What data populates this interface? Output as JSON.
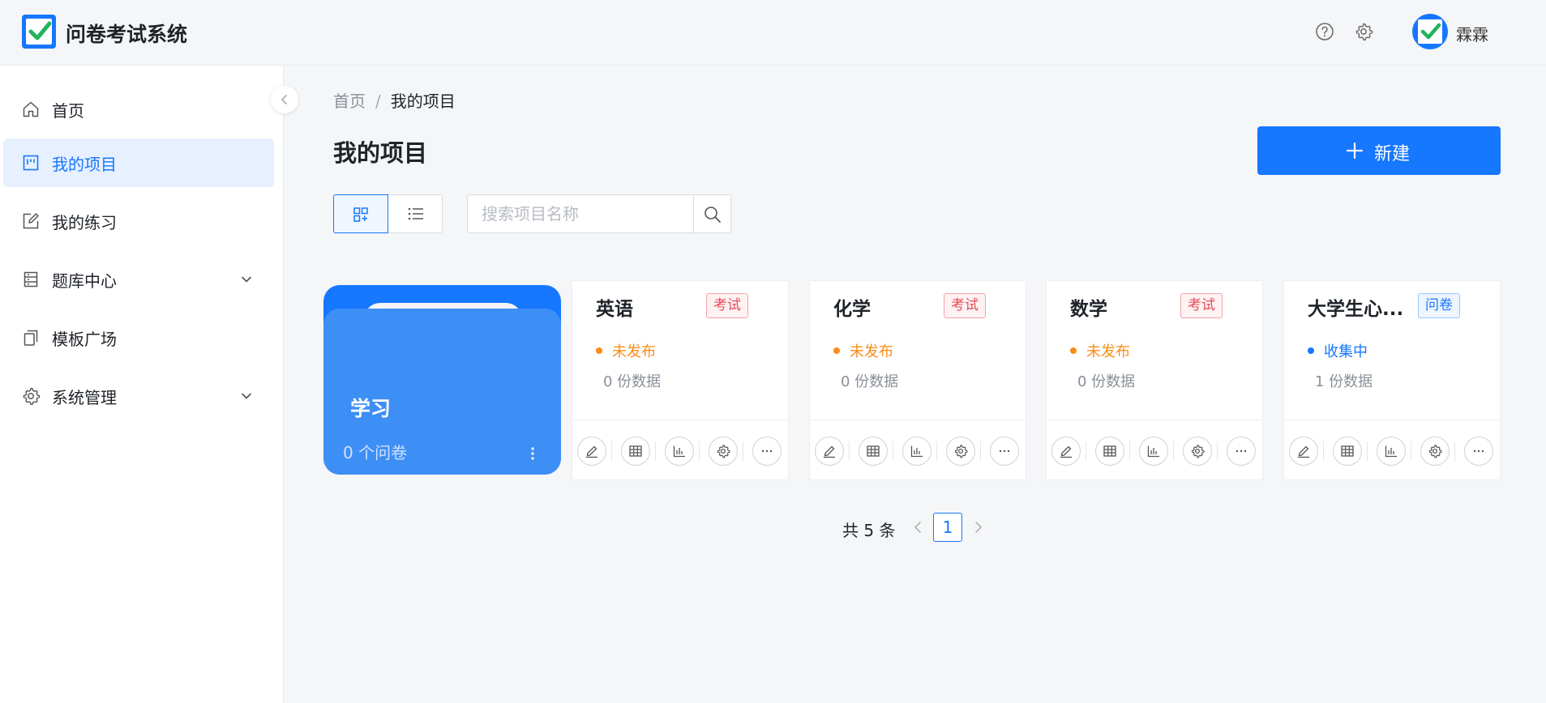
{
  "app": {
    "title": "问卷考试系统",
    "user_name": "霖霖"
  },
  "sidebar": {
    "items": [
      {
        "label": "首页",
        "icon": "home-icon"
      },
      {
        "label": "我的项目",
        "icon": "project-board-icon",
        "active": true
      },
      {
        "label": "我的练习",
        "icon": "edit-square-icon"
      },
      {
        "label": "题库中心",
        "icon": "question-bank-icon",
        "expandable": true
      },
      {
        "label": "模板广场",
        "icon": "template-copy-icon"
      },
      {
        "label": "系统管理",
        "icon": "gear-icon",
        "expandable": true
      }
    ]
  },
  "breadcrumb": {
    "home": "首页",
    "separator": "/",
    "current": "我的项目"
  },
  "main": {
    "title": "我的项目",
    "new_button": "新建",
    "search_placeholder": "搜索项目名称"
  },
  "folder": {
    "name": "学习",
    "count_text": "0 个问卷"
  },
  "projects": [
    {
      "title": "英语",
      "tag": "考试",
      "tag_type": "exam",
      "status": "未发布",
      "status_color": "#fa8c16",
      "count_text": "0  份数据"
    },
    {
      "title": "化学",
      "tag": "考试",
      "tag_type": "exam",
      "status": "未发布",
      "status_color": "#fa8c16",
      "count_text": "0  份数据"
    },
    {
      "title": "数学",
      "tag": "考试",
      "tag_type": "exam",
      "status": "未发布",
      "status_color": "#fa8c16",
      "count_text": "0  份数据"
    },
    {
      "title": "大学生心...",
      "tag": "问卷",
      "tag_type": "survey",
      "status": "收集中",
      "status_color": "#1677ff",
      "count_text": "1  份数据"
    }
  ],
  "pagination": {
    "total_text": "共 5 条",
    "current_page": "1"
  },
  "colors": {
    "primary": "#1677ff",
    "exam_tag": "#e34d59",
    "unpublished": "#fa8c16",
    "collecting": "#1677ff"
  }
}
